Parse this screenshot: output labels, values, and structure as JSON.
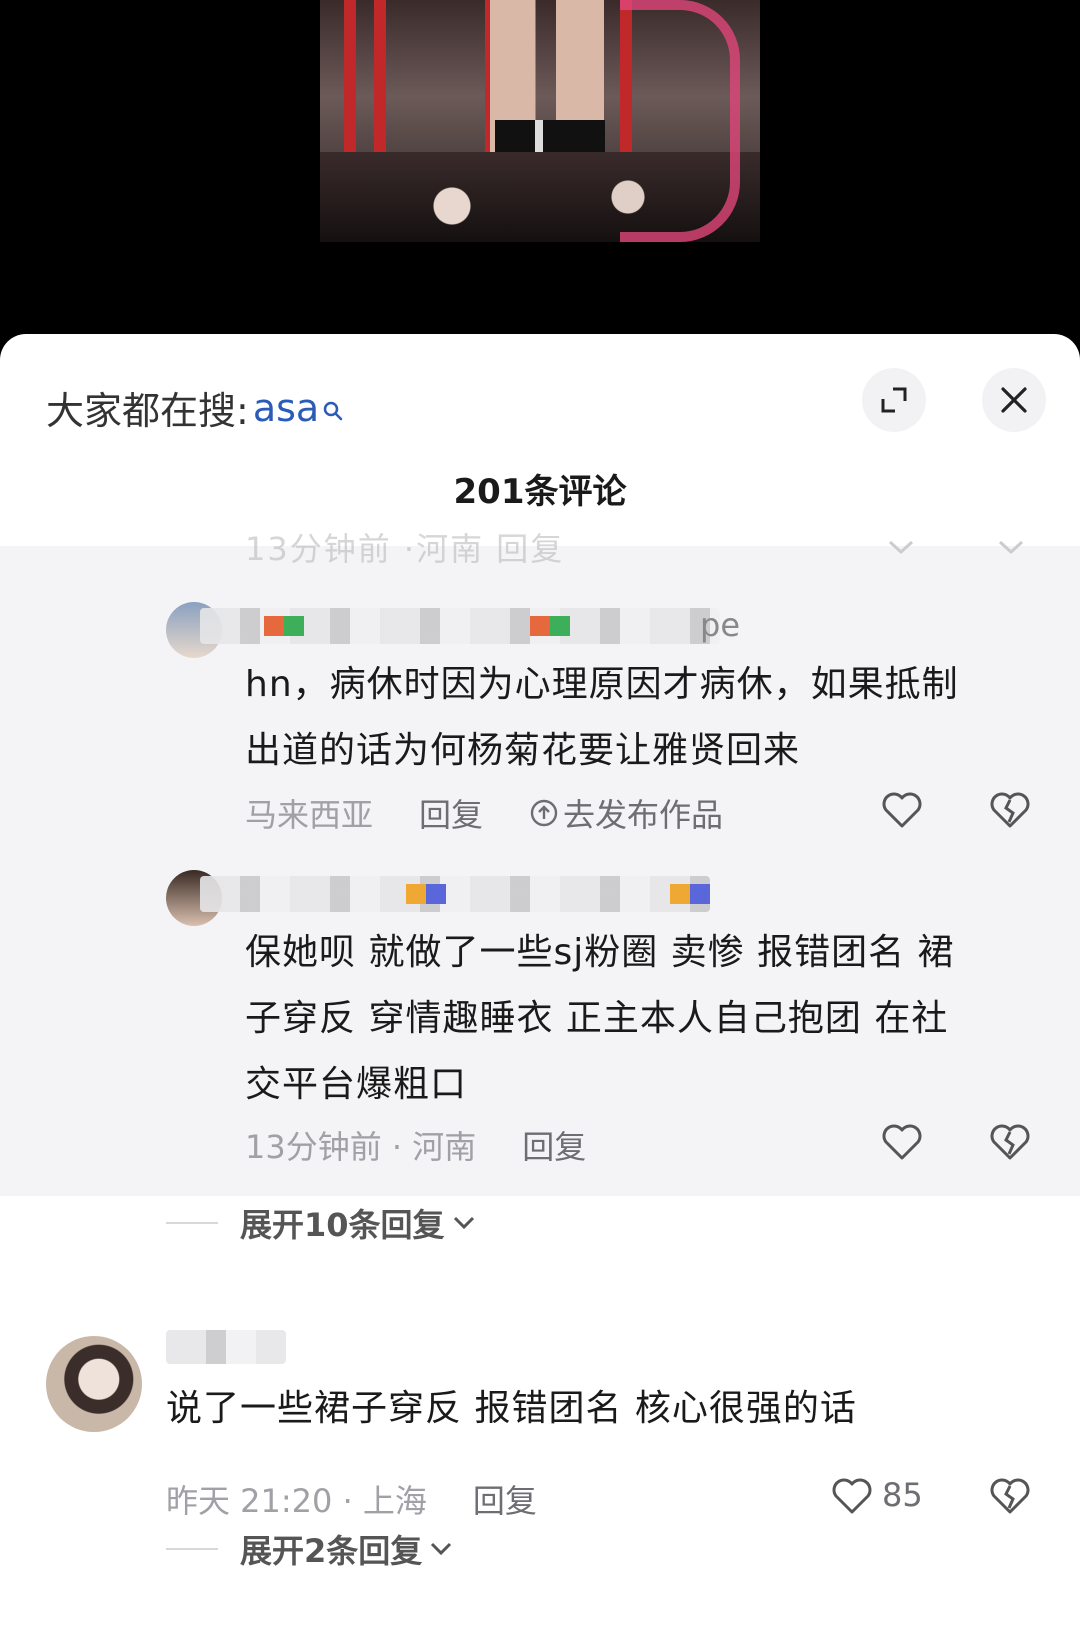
{
  "search": {
    "prefix": "大家都在搜:",
    "term": "asa"
  },
  "comments_count": "201条评论",
  "faded_row": {
    "text": "13分钟前   ·河南    回复"
  },
  "replies": [
    {
      "name_suffix": "pe",
      "text_line1": "hn，病休时因为心理原因才病休，如果抵制",
      "text_line2": "出道的话为何杨菊花要让雅贤回来",
      "location": "马来西亚",
      "reply_label": "回复",
      "publish_label": "去发布作品"
    },
    {
      "text_line1": "保她呗 就做了一些sj粉圈 卖惨 报错团名 裙",
      "text_line2": "子穿反 穿情趣睡衣 正主本人自己抱团 在社",
      "text_line3": "交平台爆粗口",
      "time_location": "13分钟前 · 河南",
      "reply_label": "回复"
    }
  ],
  "expand_1": "展开10条回复",
  "top_comment": {
    "text": "说了一些裙子穿反 报错团名 核心很强的话",
    "time_location": "昨天 21:20 · 上海",
    "reply_label": "回复",
    "likes": "85"
  },
  "expand_2": "展开2条回复",
  "colors": {
    "accent": "#2a5bb8",
    "reply_bg": "#f4f4f6"
  }
}
